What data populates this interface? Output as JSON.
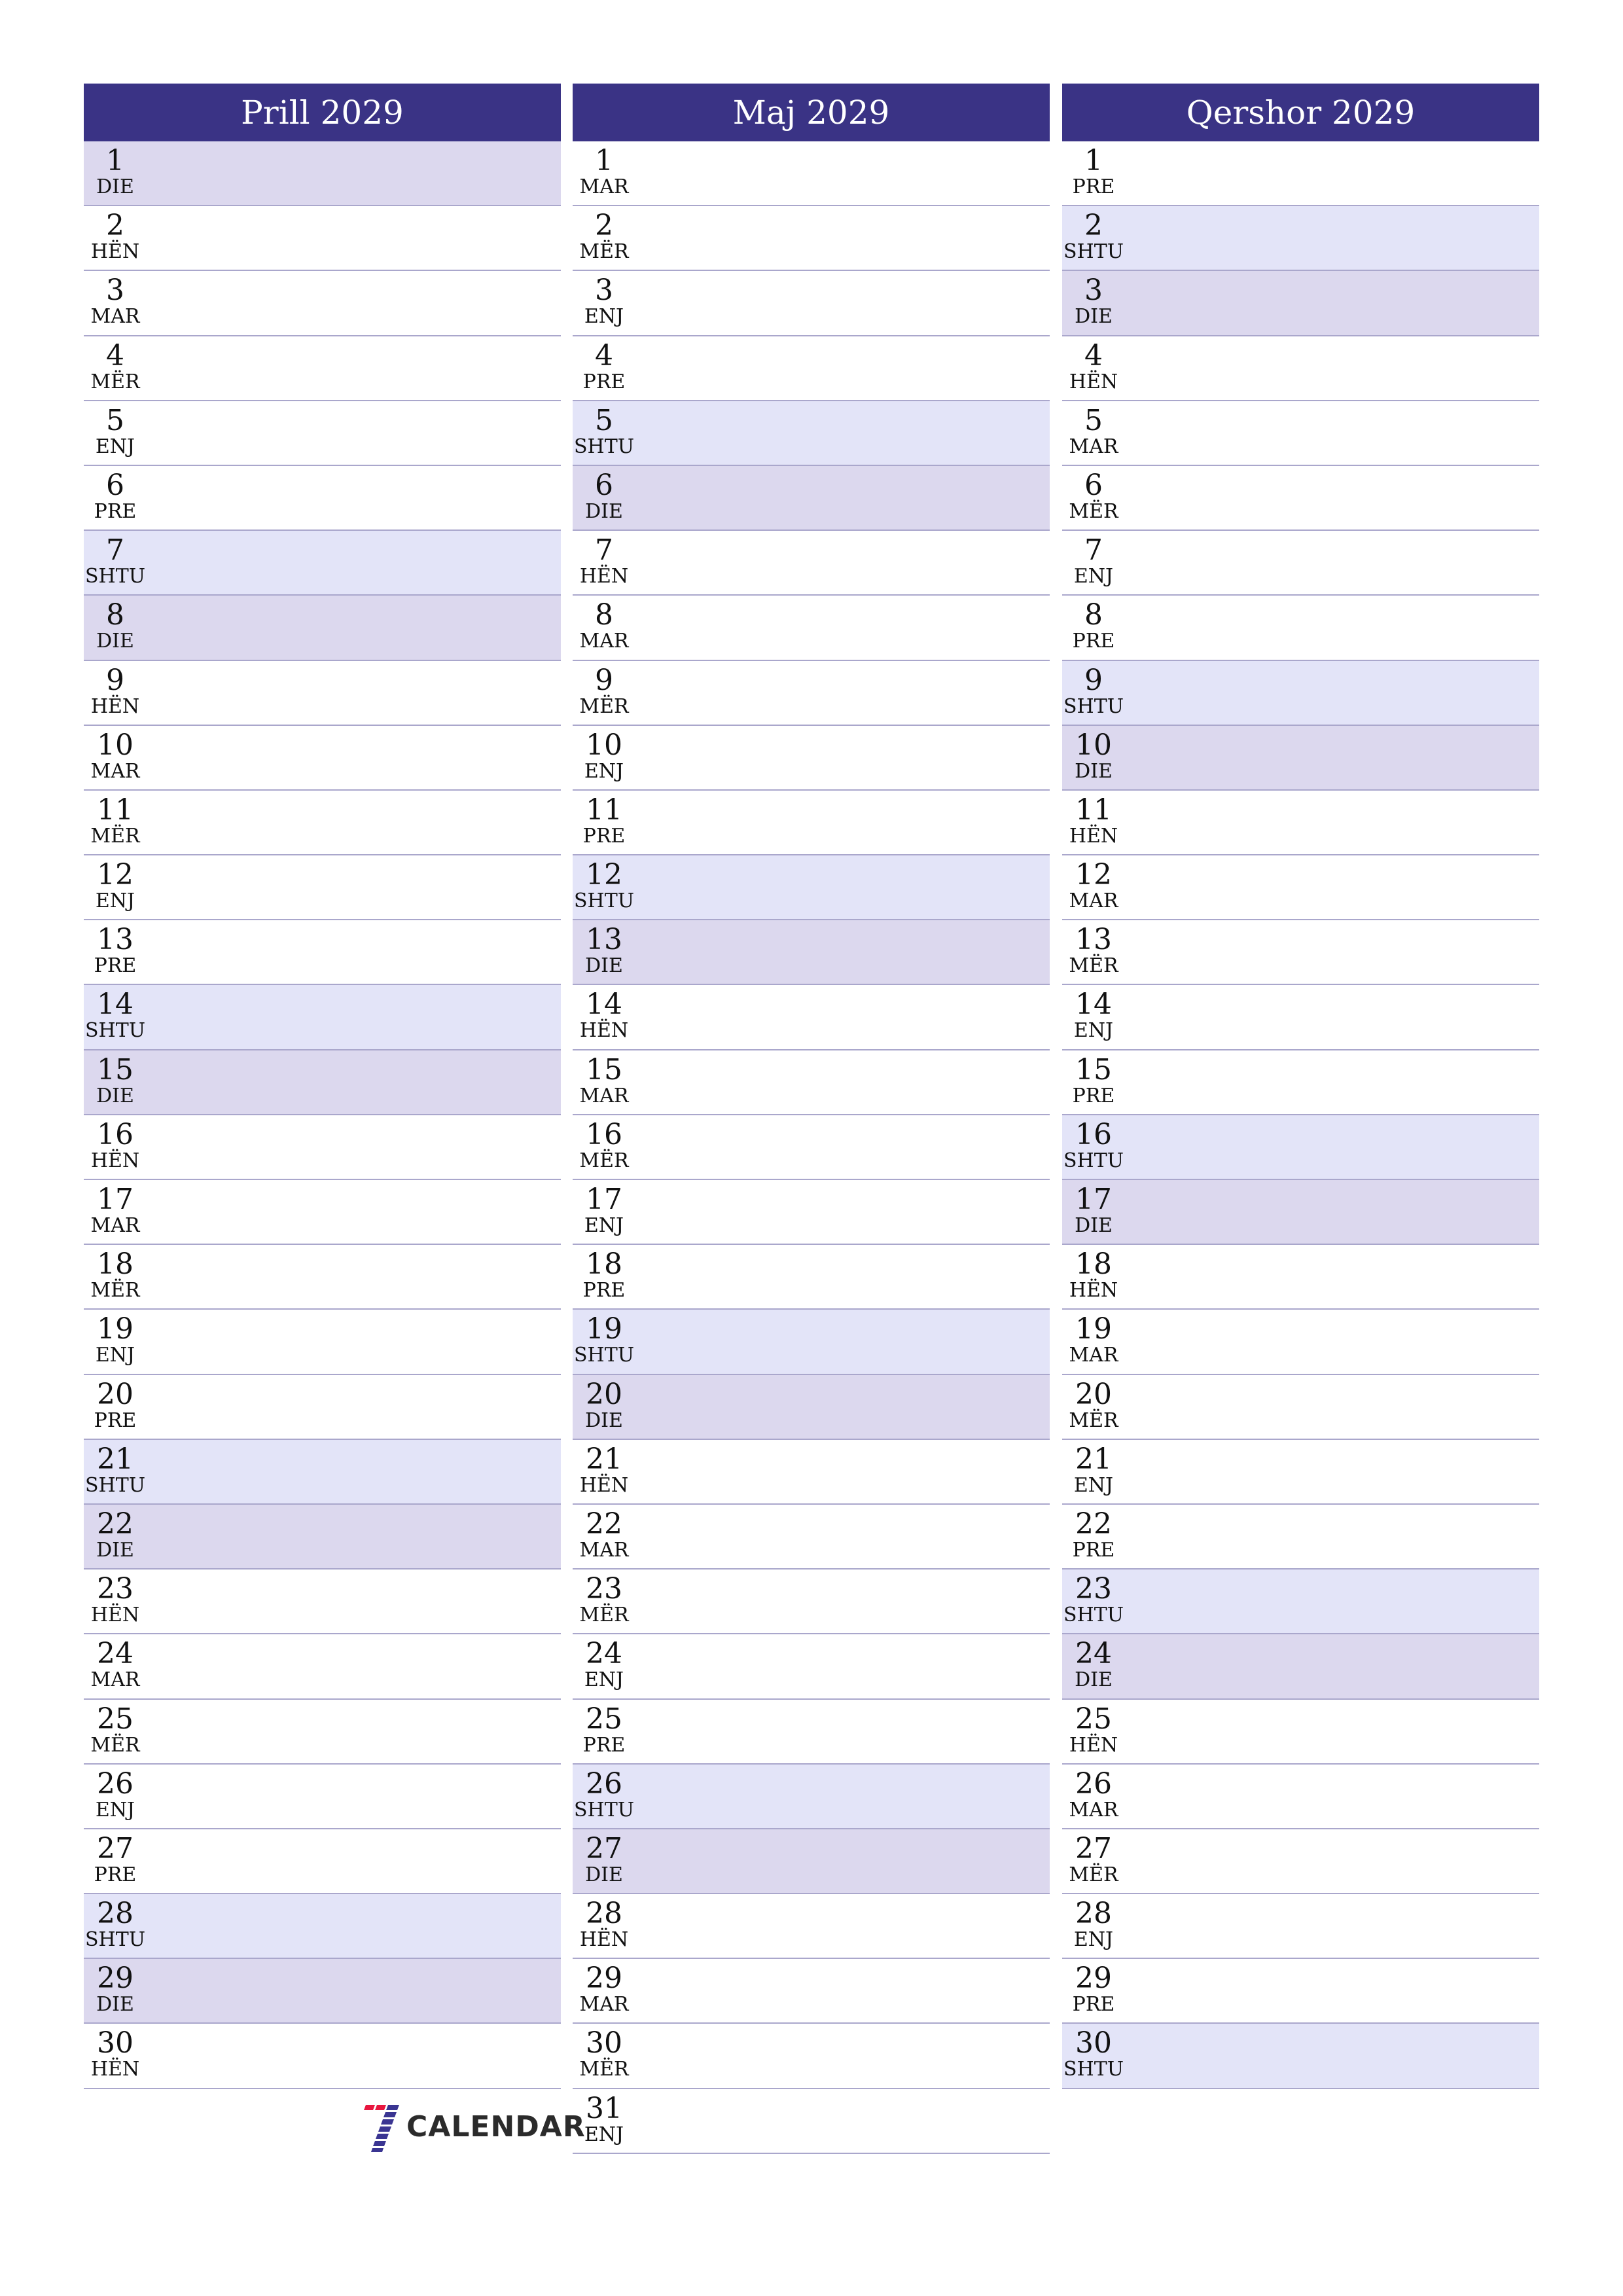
{
  "colors": {
    "header_bg": "#3a3385",
    "header_text": "#ffffff",
    "saturday_bg": "#e3e4f8",
    "sunday_bg": "#dcd8ee",
    "row_divider": "#aaa7cc",
    "logo_red": "#e8173f",
    "logo_blue": "#3a3592"
  },
  "logo": {
    "text": "CALENDAR",
    "icon": "seven-logo-icon"
  },
  "months": [
    {
      "title": "Prill 2029",
      "days": [
        {
          "n": "1",
          "wd": "DIE"
        },
        {
          "n": "2",
          "wd": "HËN"
        },
        {
          "n": "3",
          "wd": "MAR"
        },
        {
          "n": "4",
          "wd": "MËR"
        },
        {
          "n": "5",
          "wd": "ENJ"
        },
        {
          "n": "6",
          "wd": "PRE"
        },
        {
          "n": "7",
          "wd": "SHTU"
        },
        {
          "n": "8",
          "wd": "DIE"
        },
        {
          "n": "9",
          "wd": "HËN"
        },
        {
          "n": "10",
          "wd": "MAR"
        },
        {
          "n": "11",
          "wd": "MËR"
        },
        {
          "n": "12",
          "wd": "ENJ"
        },
        {
          "n": "13",
          "wd": "PRE"
        },
        {
          "n": "14",
          "wd": "SHTU"
        },
        {
          "n": "15",
          "wd": "DIE"
        },
        {
          "n": "16",
          "wd": "HËN"
        },
        {
          "n": "17",
          "wd": "MAR"
        },
        {
          "n": "18",
          "wd": "MËR"
        },
        {
          "n": "19",
          "wd": "ENJ"
        },
        {
          "n": "20",
          "wd": "PRE"
        },
        {
          "n": "21",
          "wd": "SHTU"
        },
        {
          "n": "22",
          "wd": "DIE"
        },
        {
          "n": "23",
          "wd": "HËN"
        },
        {
          "n": "24",
          "wd": "MAR"
        },
        {
          "n": "25",
          "wd": "MËR"
        },
        {
          "n": "26",
          "wd": "ENJ"
        },
        {
          "n": "27",
          "wd": "PRE"
        },
        {
          "n": "28",
          "wd": "SHTU"
        },
        {
          "n": "29",
          "wd": "DIE"
        },
        {
          "n": "30",
          "wd": "HËN"
        }
      ]
    },
    {
      "title": "Maj 2029",
      "days": [
        {
          "n": "1",
          "wd": "MAR"
        },
        {
          "n": "2",
          "wd": "MËR"
        },
        {
          "n": "3",
          "wd": "ENJ"
        },
        {
          "n": "4",
          "wd": "PRE"
        },
        {
          "n": "5",
          "wd": "SHTU"
        },
        {
          "n": "6",
          "wd": "DIE"
        },
        {
          "n": "7",
          "wd": "HËN"
        },
        {
          "n": "8",
          "wd": "MAR"
        },
        {
          "n": "9",
          "wd": "MËR"
        },
        {
          "n": "10",
          "wd": "ENJ"
        },
        {
          "n": "11",
          "wd": "PRE"
        },
        {
          "n": "12",
          "wd": "SHTU"
        },
        {
          "n": "13",
          "wd": "DIE"
        },
        {
          "n": "14",
          "wd": "HËN"
        },
        {
          "n": "15",
          "wd": "MAR"
        },
        {
          "n": "16",
          "wd": "MËR"
        },
        {
          "n": "17",
          "wd": "ENJ"
        },
        {
          "n": "18",
          "wd": "PRE"
        },
        {
          "n": "19",
          "wd": "SHTU"
        },
        {
          "n": "20",
          "wd": "DIE"
        },
        {
          "n": "21",
          "wd": "HËN"
        },
        {
          "n": "22",
          "wd": "MAR"
        },
        {
          "n": "23",
          "wd": "MËR"
        },
        {
          "n": "24",
          "wd": "ENJ"
        },
        {
          "n": "25",
          "wd": "PRE"
        },
        {
          "n": "26",
          "wd": "SHTU"
        },
        {
          "n": "27",
          "wd": "DIE"
        },
        {
          "n": "28",
          "wd": "HËN"
        },
        {
          "n": "29",
          "wd": "MAR"
        },
        {
          "n": "30",
          "wd": "MËR"
        },
        {
          "n": "31",
          "wd": "ENJ"
        }
      ]
    },
    {
      "title": "Qershor 2029",
      "days": [
        {
          "n": "1",
          "wd": "PRE"
        },
        {
          "n": "2",
          "wd": "SHTU"
        },
        {
          "n": "3",
          "wd": "DIE"
        },
        {
          "n": "4",
          "wd": "HËN"
        },
        {
          "n": "5",
          "wd": "MAR"
        },
        {
          "n": "6",
          "wd": "MËR"
        },
        {
          "n": "7",
          "wd": "ENJ"
        },
        {
          "n": "8",
          "wd": "PRE"
        },
        {
          "n": "9",
          "wd": "SHTU"
        },
        {
          "n": "10",
          "wd": "DIE"
        },
        {
          "n": "11",
          "wd": "HËN"
        },
        {
          "n": "12",
          "wd": "MAR"
        },
        {
          "n": "13",
          "wd": "MËR"
        },
        {
          "n": "14",
          "wd": "ENJ"
        },
        {
          "n": "15",
          "wd": "PRE"
        },
        {
          "n": "16",
          "wd": "SHTU"
        },
        {
          "n": "17",
          "wd": "DIE"
        },
        {
          "n": "18",
          "wd": "HËN"
        },
        {
          "n": "19",
          "wd": "MAR"
        },
        {
          "n": "20",
          "wd": "MËR"
        },
        {
          "n": "21",
          "wd": "ENJ"
        },
        {
          "n": "22",
          "wd": "PRE"
        },
        {
          "n": "23",
          "wd": "SHTU"
        },
        {
          "n": "24",
          "wd": "DIE"
        },
        {
          "n": "25",
          "wd": "HËN"
        },
        {
          "n": "26",
          "wd": "MAR"
        },
        {
          "n": "27",
          "wd": "MËR"
        },
        {
          "n": "28",
          "wd": "ENJ"
        },
        {
          "n": "29",
          "wd": "PRE"
        },
        {
          "n": "30",
          "wd": "SHTU"
        }
      ]
    }
  ]
}
